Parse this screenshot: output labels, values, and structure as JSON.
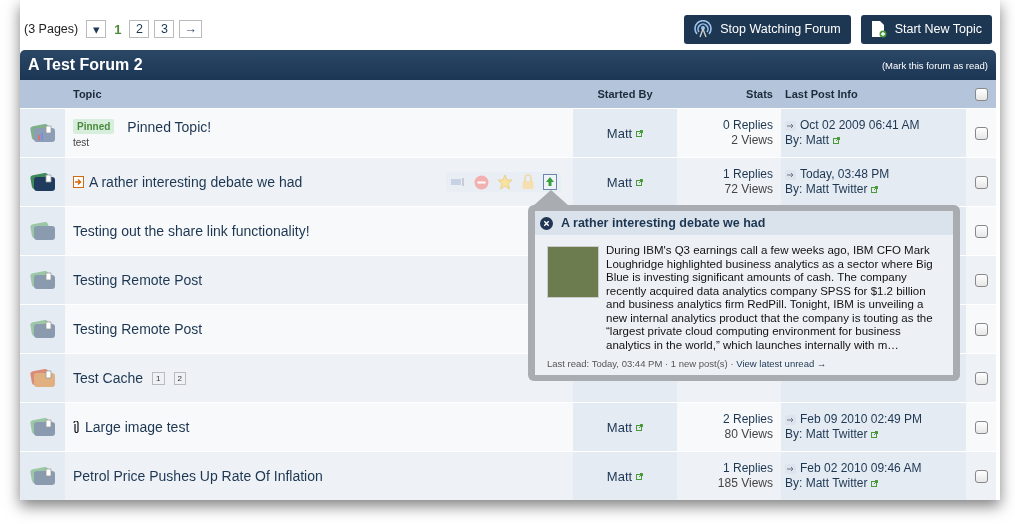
{
  "pagination": {
    "count": "(3 Pages)",
    "jump": "▾",
    "pages": [
      {
        "label": "1",
        "selected": true
      },
      {
        "label": "2",
        "selected": false
      },
      {
        "label": "3",
        "selected": false
      }
    ],
    "next": "→"
  },
  "buttons": [
    {
      "kind": "watch",
      "label": "Stop Watching Forum"
    },
    {
      "kind": "new",
      "label": "Start New Topic"
    }
  ],
  "forum": {
    "title": "A Test Forum 2",
    "mark_read": "(Mark this forum as read)"
  },
  "columns": {
    "topic": "Topic",
    "started_by": "Started By",
    "stats": "Stats",
    "last_post": "Last Post Info",
    "select_all": {
      "checked": false
    }
  },
  "topics": [
    {
      "kind": "pinned",
      "badge": "Pinned",
      "title": "Pinned Topic!",
      "description": "test",
      "started_by": "Matt",
      "replies": "0 Replies",
      "views": "2 Views",
      "last_date": "Oct 02 2009 06:41 AM",
      "last_by": "By: Matt",
      "checked": false
    },
    {
      "kind": "unread",
      "new_post": true,
      "actions": true,
      "title": "A rather interesting debate we had",
      "started_by": "Matt",
      "replies": "1 Replies",
      "views": "72 Views",
      "last_date": "Today, 03:48 PM",
      "last_by": "By: Matt Twitter",
      "checked": false
    },
    {
      "kind": "plain",
      "title": "Testing out the share link functionality!",
      "checked": false
    },
    {
      "kind": "read",
      "title": "Testing Remote Post",
      "checked": false
    },
    {
      "kind": "read",
      "title": "Testing Remote Post",
      "checked": false
    },
    {
      "kind": "hot",
      "title": "Test Cache",
      "pages": [
        "1",
        "2"
      ],
      "checked": false
    },
    {
      "kind": "read",
      "attachment": true,
      "title": "Large image test",
      "started_by": "Matt",
      "replies": "2 Replies",
      "views": "80 Views",
      "last_date": "Feb 09 2010 02:49 PM",
      "last_by": "By: Matt Twitter",
      "checked": false
    },
    {
      "kind": "read",
      "title": "Petrol Price Pushes Up Rate Of Inflation",
      "started_by": "Matt",
      "replies": "1 Replies",
      "views": "185 Views",
      "last_date": "Feb 02 2010 09:46 AM",
      "last_by": "By: Matt Twitter",
      "checked": false
    }
  ],
  "preview": {
    "title": "A rather interesting debate we had",
    "text": "During IBM's Q3 earnings call a few weeks ago, IBM CFO Mark Loughridge highlighted business analytics as a sector where Big Blue is investing significant amounts of cash. The company recently acquired data analytics company SPSS for $1.2 billion and business analytics firm RedPill. Tonight, IBM is unveiling a new internal analytics product that the company is touting as the “largest private cloud computing environment for business analytics in the world,” which launches internally with m…",
    "footer": "Last read: Today, 03:44 PM · 1 new post(s) ·",
    "link": "View latest unread →"
  }
}
